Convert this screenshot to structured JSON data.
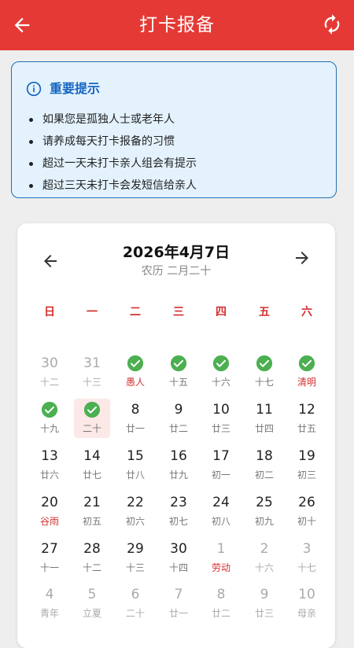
{
  "header": {
    "title": "打卡报备"
  },
  "notice": {
    "title": "重要提示",
    "items": [
      "如果您是孤独人士或老年人",
      "请养成每天打卡报备的习惯",
      "超过一天未打卡亲人组会有提示",
      "超过三天未打卡会发短信给亲人"
    ]
  },
  "calendar": {
    "month_title": "2026年4月7日",
    "lunar_title": "农历 二月二十",
    "weekdays": [
      "日",
      "一",
      "二",
      "三",
      "四",
      "五",
      "六"
    ],
    "colors": {
      "accent": "#e53935",
      "check": "#4caf50",
      "info": "#1565c0"
    },
    "days": [
      {
        "num": "30",
        "lunar": "十二",
        "out": true
      },
      {
        "num": "31",
        "lunar": "十三",
        "out": true
      },
      {
        "num": "",
        "lunar": "愚人",
        "checked": true,
        "festival": true
      },
      {
        "num": "",
        "lunar": "十五",
        "checked": true
      },
      {
        "num": "",
        "lunar": "十六",
        "checked": true
      },
      {
        "num": "",
        "lunar": "十七",
        "checked": true
      },
      {
        "num": "",
        "lunar": "清明",
        "checked": true,
        "festival": true
      },
      {
        "num": "",
        "lunar": "十九",
        "checked": true
      },
      {
        "num": "",
        "lunar": "二十",
        "checked": true,
        "selected": true
      },
      {
        "num": "8",
        "lunar": "廿一"
      },
      {
        "num": "9",
        "lunar": "廿二"
      },
      {
        "num": "10",
        "lunar": "廿三"
      },
      {
        "num": "11",
        "lunar": "廿四"
      },
      {
        "num": "12",
        "lunar": "廿五"
      },
      {
        "num": "13",
        "lunar": "廿六"
      },
      {
        "num": "14",
        "lunar": "廿七"
      },
      {
        "num": "15",
        "lunar": "廿八"
      },
      {
        "num": "16",
        "lunar": "廿九"
      },
      {
        "num": "17",
        "lunar": "初一"
      },
      {
        "num": "18",
        "lunar": "初二"
      },
      {
        "num": "19",
        "lunar": "初三"
      },
      {
        "num": "20",
        "lunar": "谷雨",
        "festival": true
      },
      {
        "num": "21",
        "lunar": "初五"
      },
      {
        "num": "22",
        "lunar": "初六"
      },
      {
        "num": "23",
        "lunar": "初七"
      },
      {
        "num": "24",
        "lunar": "初八"
      },
      {
        "num": "25",
        "lunar": "初九"
      },
      {
        "num": "26",
        "lunar": "初十"
      },
      {
        "num": "27",
        "lunar": "十一"
      },
      {
        "num": "28",
        "lunar": "十二"
      },
      {
        "num": "29",
        "lunar": "十三"
      },
      {
        "num": "30",
        "lunar": "十四"
      },
      {
        "num": "1",
        "lunar": "劳动",
        "out": true,
        "festival": true
      },
      {
        "num": "2",
        "lunar": "十六",
        "out": true
      },
      {
        "num": "3",
        "lunar": "十七",
        "out": true
      },
      {
        "num": "4",
        "lunar": "青年",
        "out": true
      },
      {
        "num": "5",
        "lunar": "立夏",
        "out": true
      },
      {
        "num": "6",
        "lunar": "二十",
        "out": true
      },
      {
        "num": "7",
        "lunar": "廿一",
        "out": true
      },
      {
        "num": "8",
        "lunar": "廿二",
        "out": true
      },
      {
        "num": "9",
        "lunar": "廿三",
        "out": true
      },
      {
        "num": "10",
        "lunar": "母亲",
        "out": true
      }
    ]
  }
}
